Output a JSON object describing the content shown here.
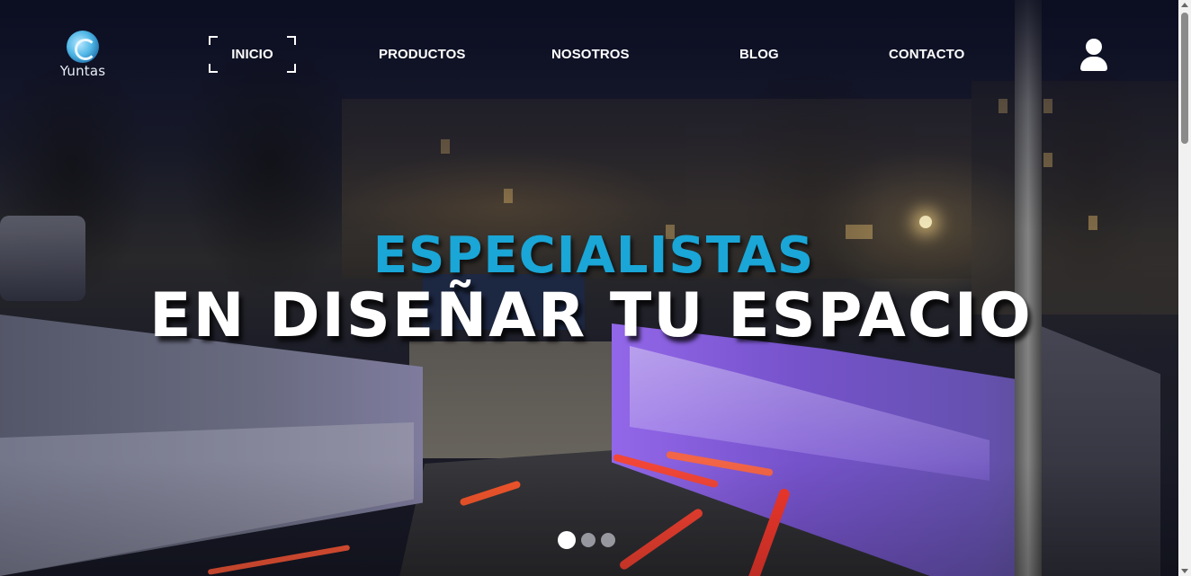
{
  "brand": {
    "name": "Yuntas",
    "logo_icon": "yuntas-logo-icon",
    "accent_color": "#1aa6d6"
  },
  "nav": {
    "items": [
      {
        "label": "INICIO",
        "active": true
      },
      {
        "label": "PRODUCTOS",
        "active": false
      },
      {
        "label": "NOSOTROS",
        "active": false
      },
      {
        "label": "BLOG",
        "active": false
      },
      {
        "label": "CONTACTO",
        "active": false
      }
    ],
    "user_icon": "user-icon"
  },
  "hero": {
    "headline_top": "ESPECIALISTAS",
    "headline_bottom": "EN DISEÑAR TU ESPACIO",
    "background_image": "night-tunnel-photo",
    "carousel": {
      "slides": 3,
      "active_index": 0
    }
  }
}
